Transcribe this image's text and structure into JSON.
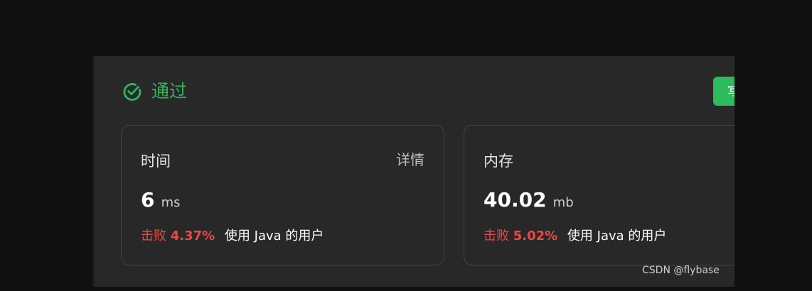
{
  "status": {
    "label": "通过",
    "icon": "check-circle-icon",
    "color": "#2db55d"
  },
  "toolbar": {
    "write_label": "写题解",
    "accent": "#2cbb5d"
  },
  "time_card": {
    "label": "时间",
    "detail_label": "详情",
    "value": "6",
    "unit": "ms",
    "beats_prefix": "击败",
    "beats_percent": "4.37%",
    "beats_suffix": "使用 Java 的用户"
  },
  "memory_card": {
    "label": "内存",
    "value": "40.02",
    "unit": "mb",
    "beats_prefix": "击败",
    "beats_percent": "5.02%",
    "beats_suffix": "使用 Java 的用户"
  },
  "watermark": "CSDN @flybase"
}
